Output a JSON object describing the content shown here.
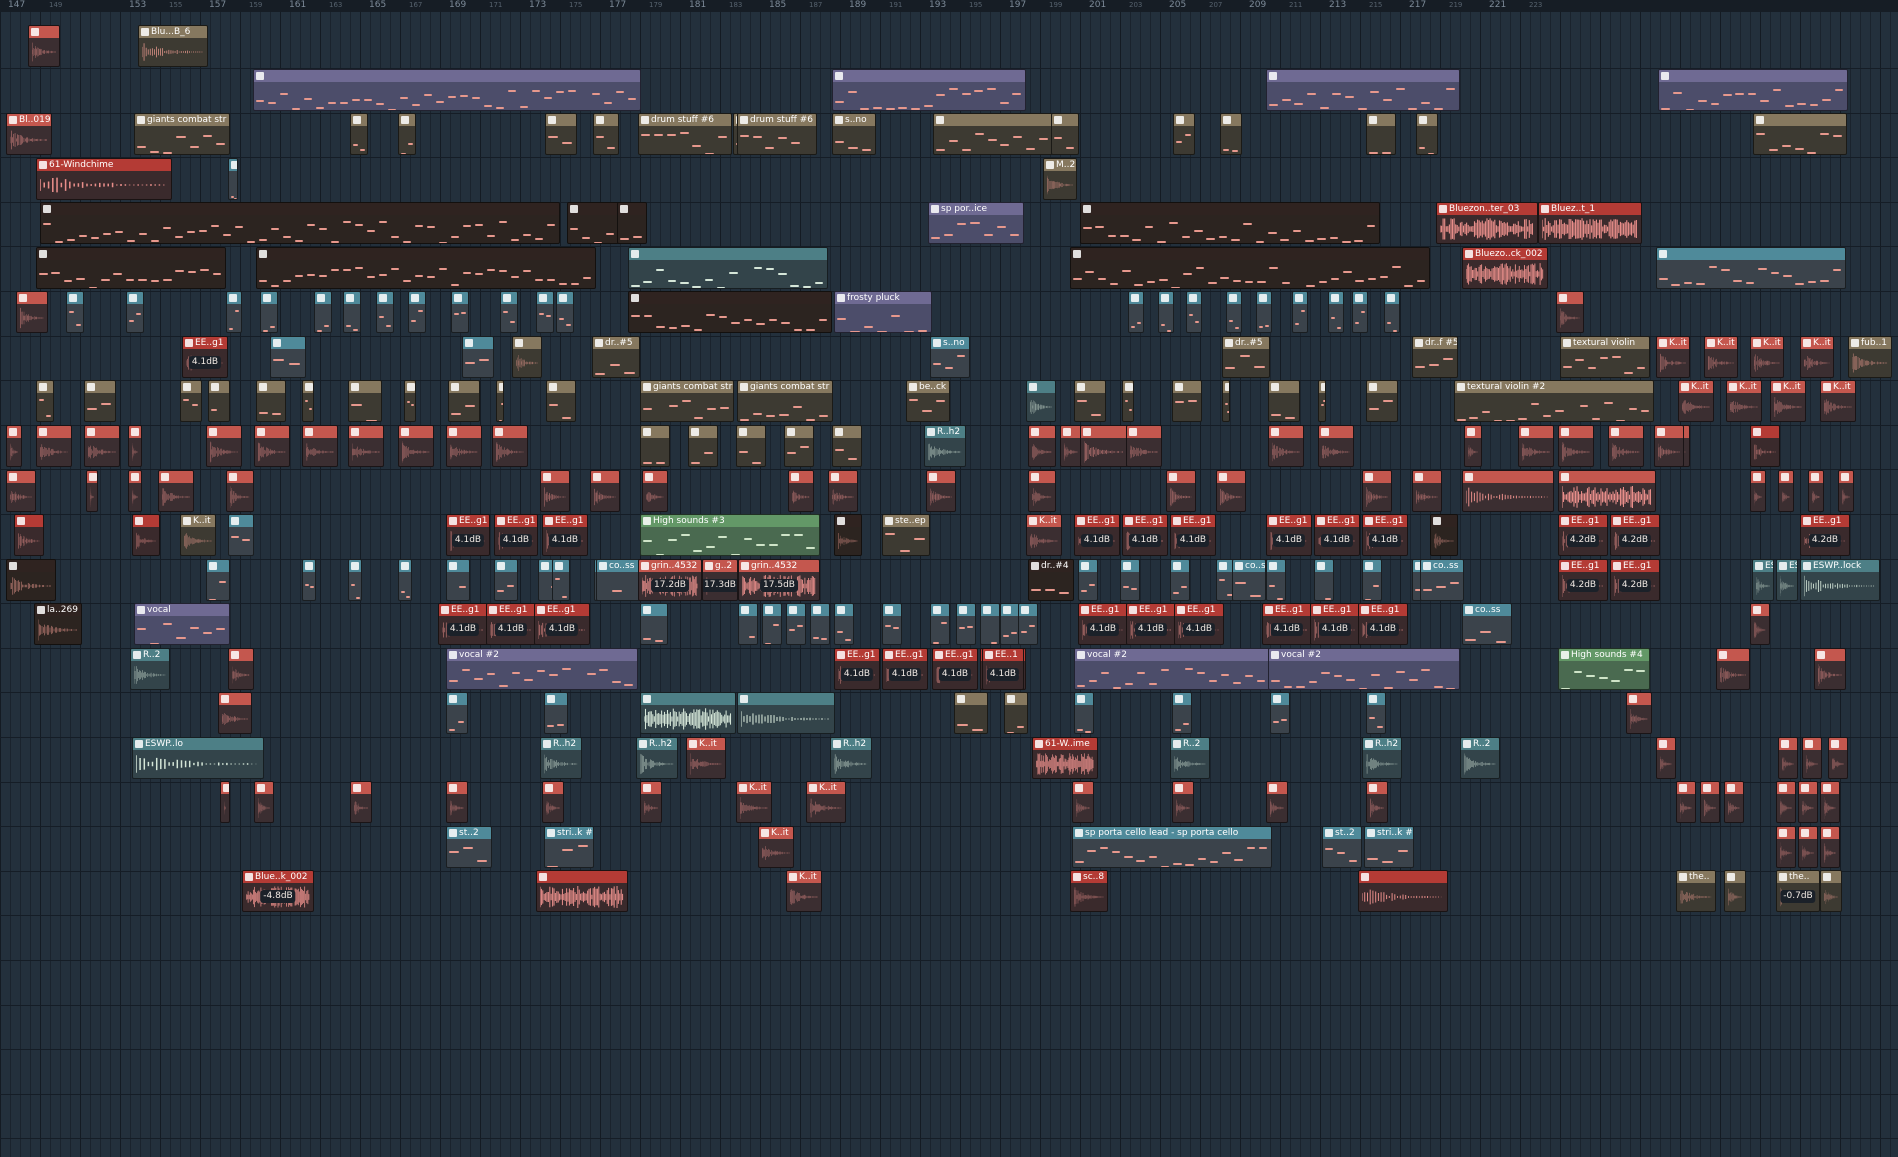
{
  "app": "FL Studio Playlist",
  "ruler": {
    "major": [
      "147",
      "149",
      "153",
      "155",
      "157",
      "159",
      "161",
      "163",
      "165",
      "167",
      "169",
      "171",
      "173",
      "175",
      "177",
      "179",
      "181",
      "183",
      "185",
      "187",
      "189",
      "191",
      "193",
      "195",
      "197",
      "199",
      "201",
      "203",
      "205",
      "207",
      "209",
      "211",
      "213",
      "215",
      "217",
      "219",
      "221",
      "223"
    ]
  },
  "colors": {
    "bg": "#23303c",
    "grid": "#1a232d",
    "audio_red": "#c0413a",
    "audio_salmon": "#e88e8a",
    "pattern_blue": "#5b8fa0",
    "pattern_purple": "#736f95",
    "pattern_tan": "#8b7b62",
    "pattern_green": "#6a9a6c",
    "wave_light": "#d5e6d8",
    "note": "#f0a294"
  },
  "clips": [
    {
      "label": "",
      "type": "audio"
    },
    {
      "label": "Blu...B_6",
      "type": "audio"
    },
    {
      "label": "Bl..019",
      "type": "audio"
    },
    {
      "label": "giants combat str",
      "type": "pattern"
    },
    {
      "label": "drum stuff #6",
      "type": "pattern"
    },
    {
      "label": "drum stuff #6",
      "type": "pattern"
    },
    {
      "label": "s..no",
      "type": "pattern"
    },
    {
      "label": "61-Windchime",
      "type": "audio"
    },
    {
      "label": "M..2",
      "type": "audio"
    },
    {
      "label": "sp por..ice",
      "type": "pattern"
    },
    {
      "label": "Bluezon..ter_03",
      "type": "audio"
    },
    {
      "label": "Bluez..t_1",
      "type": "audio"
    },
    {
      "label": "Bluezo..ck_002",
      "type": "audio"
    },
    {
      "label": "frosty pluck",
      "type": "pattern"
    },
    {
      "label": "EE..g1",
      "type": "audio",
      "gain": "4.1dB"
    },
    {
      "label": "dr..#5",
      "type": "pattern"
    },
    {
      "label": "s..no",
      "type": "pattern"
    },
    {
      "label": "dr..#5",
      "type": "pattern"
    },
    {
      "label": "dr..f #5",
      "type": "pattern"
    },
    {
      "label": "textural violin",
      "type": "pattern"
    },
    {
      "label": "fub..1",
      "type": "audio"
    },
    {
      "label": "giants combat str",
      "type": "pattern"
    },
    {
      "label": "giants combat str",
      "type": "pattern"
    },
    {
      "label": "be..ck",
      "type": "pattern"
    },
    {
      "label": "textural violin #2",
      "type": "pattern"
    },
    {
      "label": "R..h2",
      "type": "audio"
    },
    {
      "label": "High sounds #3",
      "type": "pattern"
    },
    {
      "label": "ste..ep",
      "type": "pattern"
    },
    {
      "label": "grin..4532",
      "type": "audio",
      "gain": "17.2dB"
    },
    {
      "label": "g..2",
      "type": "audio",
      "gain": "17.3dB"
    },
    {
      "label": "grin..4532",
      "type": "audio",
      "gain": "17.5dB"
    },
    {
      "label": "co..ss",
      "type": "pattern"
    },
    {
      "label": "dr..#4",
      "type": "pattern"
    },
    {
      "label": "ESW",
      "type": "audio"
    },
    {
      "label": "ESW",
      "type": "audio"
    },
    {
      "label": "ESWP..lock",
      "type": "audio"
    },
    {
      "label": "la..269",
      "type": "audio"
    },
    {
      "label": "vocal",
      "type": "pattern"
    },
    {
      "label": "R..2",
      "type": "audio"
    },
    {
      "label": "vocal #2",
      "type": "pattern"
    },
    {
      "label": "vocal #2",
      "type": "pattern"
    },
    {
      "label": "vocal #2",
      "type": "pattern"
    },
    {
      "label": "EE..1",
      "type": "audio",
      "gain": "4.1dB"
    },
    {
      "label": "High sounds #4",
      "type": "pattern"
    },
    {
      "label": "61-W..ime",
      "type": "audio"
    },
    {
      "label": "ESWP..lo",
      "type": "audio"
    },
    {
      "label": "st..2",
      "type": "pattern"
    },
    {
      "label": "stri..k #2",
      "type": "pattern"
    },
    {
      "label": "sp porta cello lead - sp porta cello",
      "type": "pattern"
    },
    {
      "label": "str..k #2",
      "type": "pattern"
    },
    {
      "label": "Blue..k_002",
      "type": "audio",
      "gain": "-4.8dB"
    },
    {
      "label": "sc..8",
      "type": "audio"
    },
    {
      "label": "the..",
      "type": "audio"
    },
    {
      "label": "-0.7dB",
      "type": "gain"
    },
    {
      "label": "K..it",
      "type": "audio"
    },
    {
      "label": "4.2dB",
      "type": "gain"
    }
  ]
}
